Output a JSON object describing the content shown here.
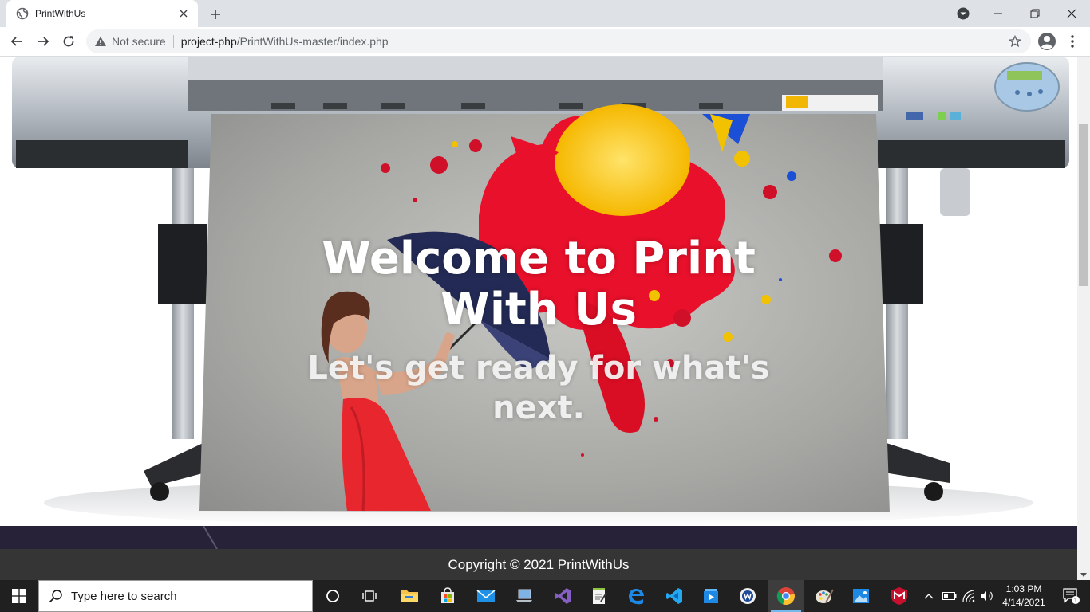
{
  "browser": {
    "tab_title": "PrintWithUs",
    "security_label": "Not secure",
    "url_host": "project-php",
    "url_path": "/PrintWithUs-master/index.php"
  },
  "hero": {
    "title": "Welcome to Print With Us",
    "subtitle": "Let's get ready for what's next."
  },
  "footer": {
    "copyright": "Copyright © 2021 PrintWithUs"
  },
  "taskbar": {
    "search_placeholder": "Type here to search",
    "time": "1:03 PM",
    "date": "4/14/2021",
    "notification_count": "1",
    "pinned_apps": [
      "cortana",
      "task-view",
      "file-explorer",
      "microsoft-store",
      "mail",
      "this-pc",
      "visual-studio",
      "notepad",
      "edge",
      "vs-code",
      "video-app",
      "word",
      "chrome",
      "paint",
      "photos",
      "mcafee"
    ],
    "active_app": "chrome"
  }
}
